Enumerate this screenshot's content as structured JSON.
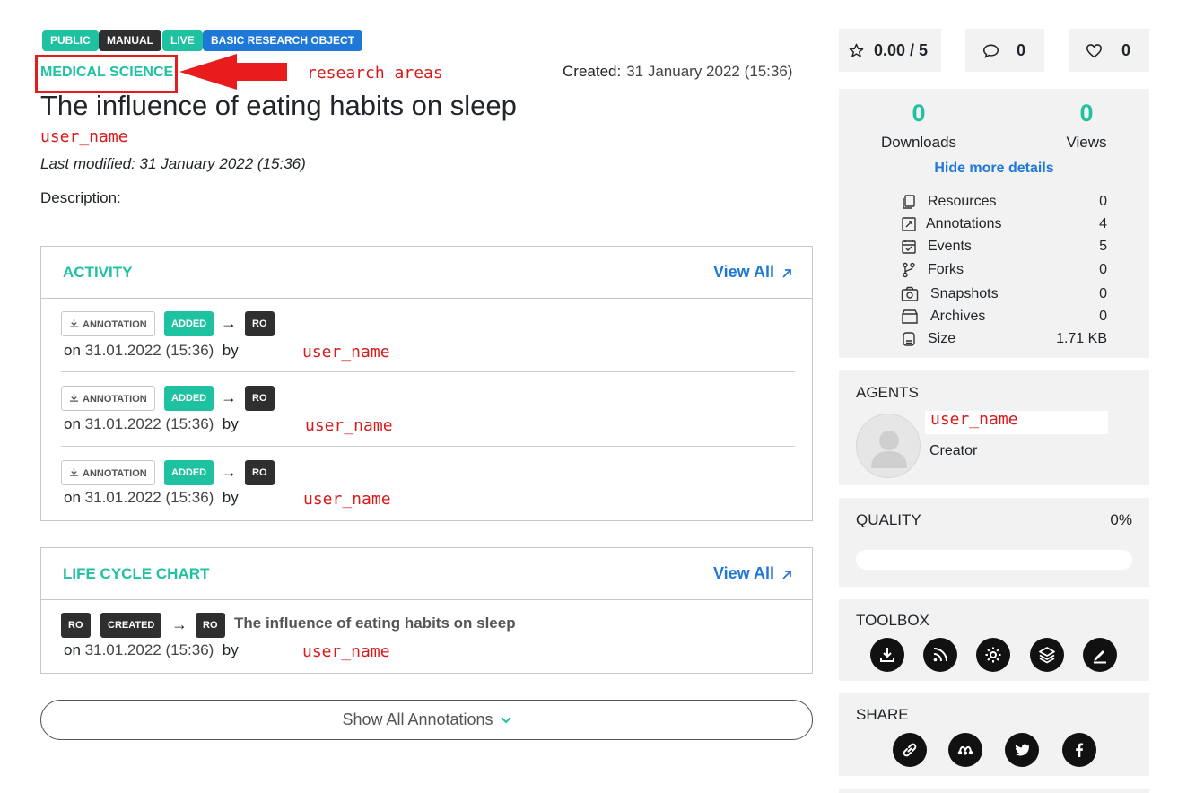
{
  "badges": [
    "PUBLIC",
    "MANUAL",
    "LIVE",
    "BASIC RESEARCH OBJECT"
  ],
  "research_area": "MEDICAL SCIENCE",
  "annotation_research_areas": "research areas",
  "created_label": "Created:",
  "created_value": "31 January 2022 (15:36)",
  "title": "The influence of eating habits on sleep",
  "author": "user_name",
  "last_modified": "Last modified: 31 January 2022 (15:36)",
  "description_label": "Description:",
  "activity": {
    "title": "ACTIVITY",
    "view_all": "View All",
    "items": [
      {
        "type": "ANNOTATION",
        "action": "ADDED",
        "target": "RO",
        "on_prefix": "on",
        "date": "31.01.2022 (15:36)",
        "by": "by",
        "user": "user_name"
      },
      {
        "type": "ANNOTATION",
        "action": "ADDED",
        "target": "RO",
        "on_prefix": "on",
        "date": "31.01.2022 (15:36)",
        "by": "by",
        "user": "user_name"
      },
      {
        "type": "ANNOTATION",
        "action": "ADDED",
        "target": "RO",
        "on_prefix": "on",
        "date": "31.01.2022 (15:36)",
        "by": "by",
        "user": "user_name"
      }
    ]
  },
  "lifecycle": {
    "title": "LIFE CYCLE CHART",
    "view_all": "View All",
    "item": {
      "from": "RO",
      "action": "CREATED",
      "to": "RO",
      "name": "The influence of eating habits on sleep",
      "on_prefix": "on",
      "date": "31.01.2022 (15:36)",
      "by": "by",
      "user": "user_name"
    }
  },
  "show_all_annotations": "Show All Annotations",
  "sidebar": {
    "rating": "0.00 / 5",
    "comments": "0",
    "likes": "0",
    "downloads": {
      "value": "0",
      "label": "Downloads"
    },
    "views": {
      "value": "0",
      "label": "Views"
    },
    "hide_more": "Hide more details",
    "details": [
      {
        "icon": "resources-icon",
        "label": "Resources",
        "value": "0"
      },
      {
        "icon": "annotations-icon",
        "label": "Annotations",
        "value": "4"
      },
      {
        "icon": "events-icon",
        "label": "Events",
        "value": "5"
      },
      {
        "icon": "forks-icon",
        "label": "Forks",
        "value": "0"
      },
      {
        "icon": "snapshots-icon",
        "label": "Snapshots",
        "value": "0"
      },
      {
        "icon": "archives-icon",
        "label": "Archives",
        "value": "0"
      },
      {
        "icon": "size-icon",
        "label": "Size",
        "value": "1.71 KB"
      }
    ],
    "agents_title": "AGENTS",
    "agent_name": "user_name",
    "agent_role": "Creator",
    "quality_title": "QUALITY",
    "quality_value": "0%",
    "quality_fraction": 0,
    "toolbox_title": "TOOLBOX",
    "toolbox_icons": [
      "download-icon",
      "rss-icon",
      "settings-icon",
      "layers-icon",
      "edit-icon"
    ],
    "share_title": "SHARE",
    "share_icons": [
      "link-icon",
      "mendeley-icon",
      "twitter-icon",
      "facebook-icon"
    ]
  },
  "colors": {
    "accent_teal": "#1fc2a0",
    "accent_blue": "#1f78d8",
    "dark": "#2f2f2f",
    "annotation_red": "#d81a1a"
  }
}
